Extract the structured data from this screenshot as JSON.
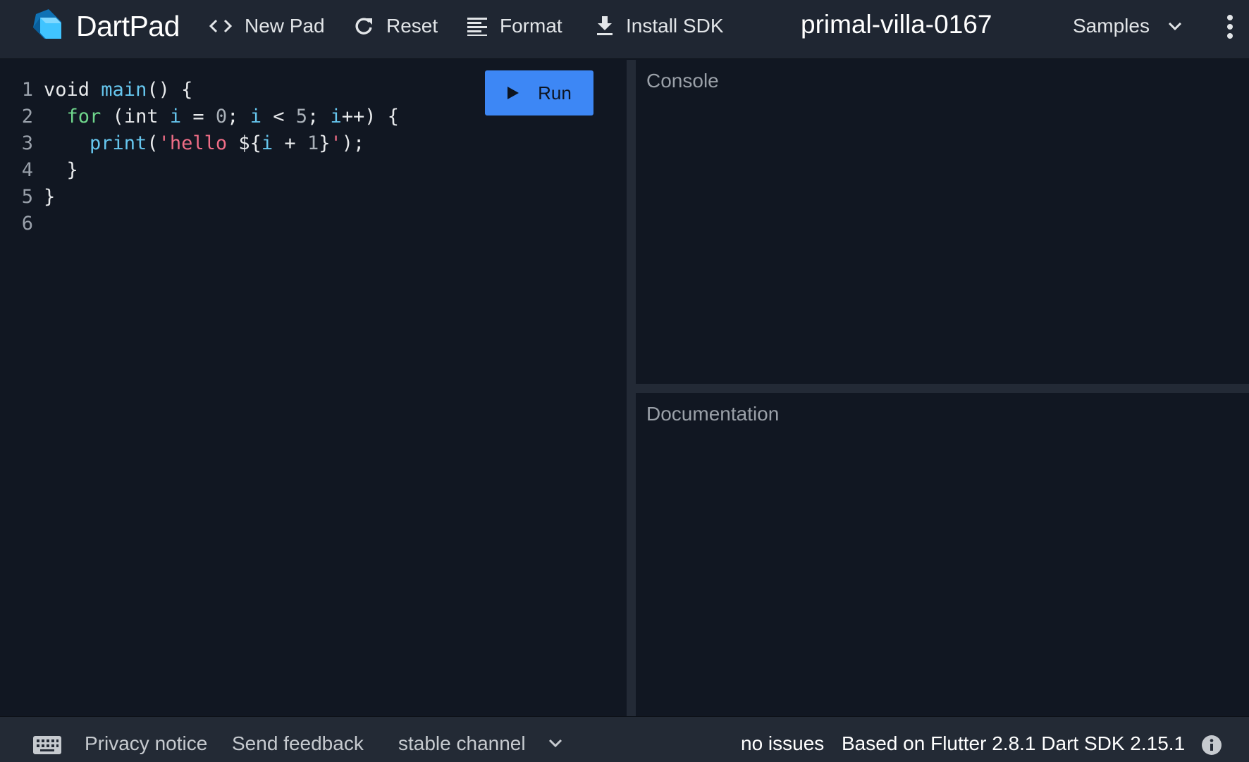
{
  "header": {
    "brand": "DartPad",
    "new_pad_label": "New Pad",
    "reset_label": "Reset",
    "format_label": "Format",
    "install_sdk_label": "Install SDK",
    "pad_title": "primal-villa-0167",
    "samples_label": "Samples",
    "icons": [
      "dart-logo",
      "code-brackets-icon",
      "refresh-icon",
      "format-align-icon",
      "download-icon",
      "chevron-down-icon",
      "more-vert-icon"
    ]
  },
  "editor": {
    "line_numbers": [
      "1",
      "2",
      "3",
      "4",
      "5",
      "6"
    ],
    "lines": [
      "void main() {",
      "  for (int i = 0; i < 5; i++) {",
      "    print('hello ${i + 1}');",
      "  }",
      "}",
      ""
    ],
    "run_label": "Run"
  },
  "console": {
    "label": "Console"
  },
  "documentation": {
    "label": "Documentation"
  },
  "footer": {
    "privacy_label": "Privacy notice",
    "feedback_label": "Send feedback",
    "channel_label": "stable channel",
    "issues_label": "no issues",
    "version_label": "Based on Flutter 2.8.1 Dart SDK 2.15.1",
    "icons": [
      "keyboard-icon",
      "chevron-down-icon",
      "info-icon"
    ]
  },
  "colors": {
    "header_bg": "#1f2632",
    "editor_bg": "#111722",
    "footer_bg": "#232a35",
    "run_button": "#3d87f5",
    "string": "#ef6d86",
    "identifier": "#66c6ee",
    "control": "#6fd68c"
  }
}
